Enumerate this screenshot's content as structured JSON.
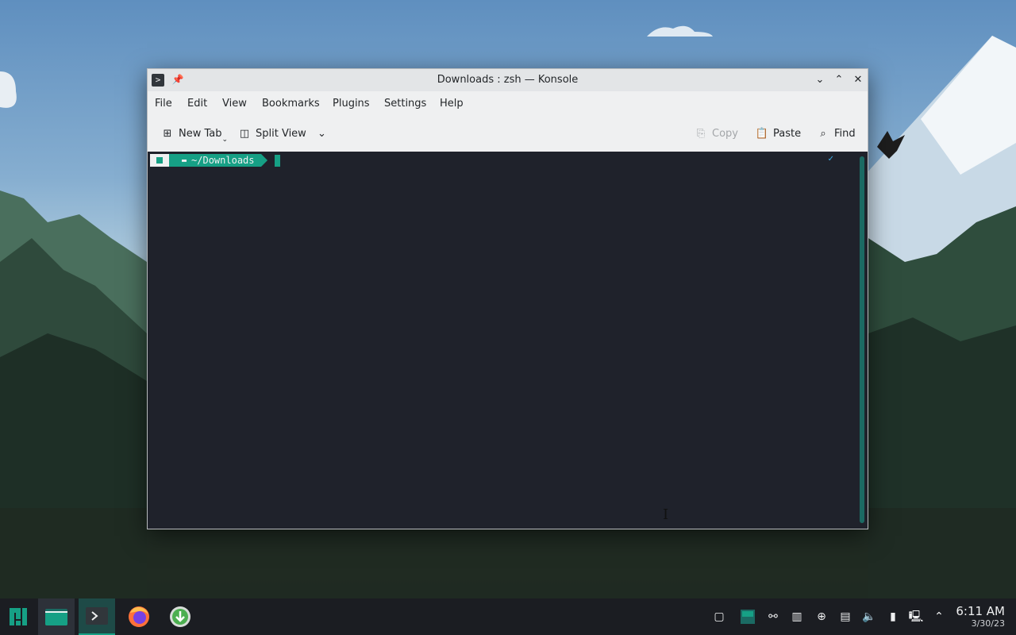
{
  "window": {
    "title": "Downloads : zsh — Konsole",
    "buttons": [
      "minimize",
      "maximize",
      "close"
    ]
  },
  "menubar": {
    "items": [
      "File",
      "Edit",
      "View",
      "Bookmarks",
      "Plugins",
      "Settings",
      "Help"
    ]
  },
  "toolbar": {
    "new_tab": "New Tab",
    "split_view": "Split View",
    "copy": "Copy",
    "paste": "Paste",
    "find": "Find"
  },
  "terminal": {
    "prompt_dir": "~/Downloads",
    "status_check": "✓"
  },
  "taskbar": {
    "time": "6:11 AM",
    "date": "3/30/23"
  },
  "colors": {
    "accent": "#16a085",
    "terminal_bg": "#1f222b",
    "taskbar_bg": "#1b1d22"
  }
}
